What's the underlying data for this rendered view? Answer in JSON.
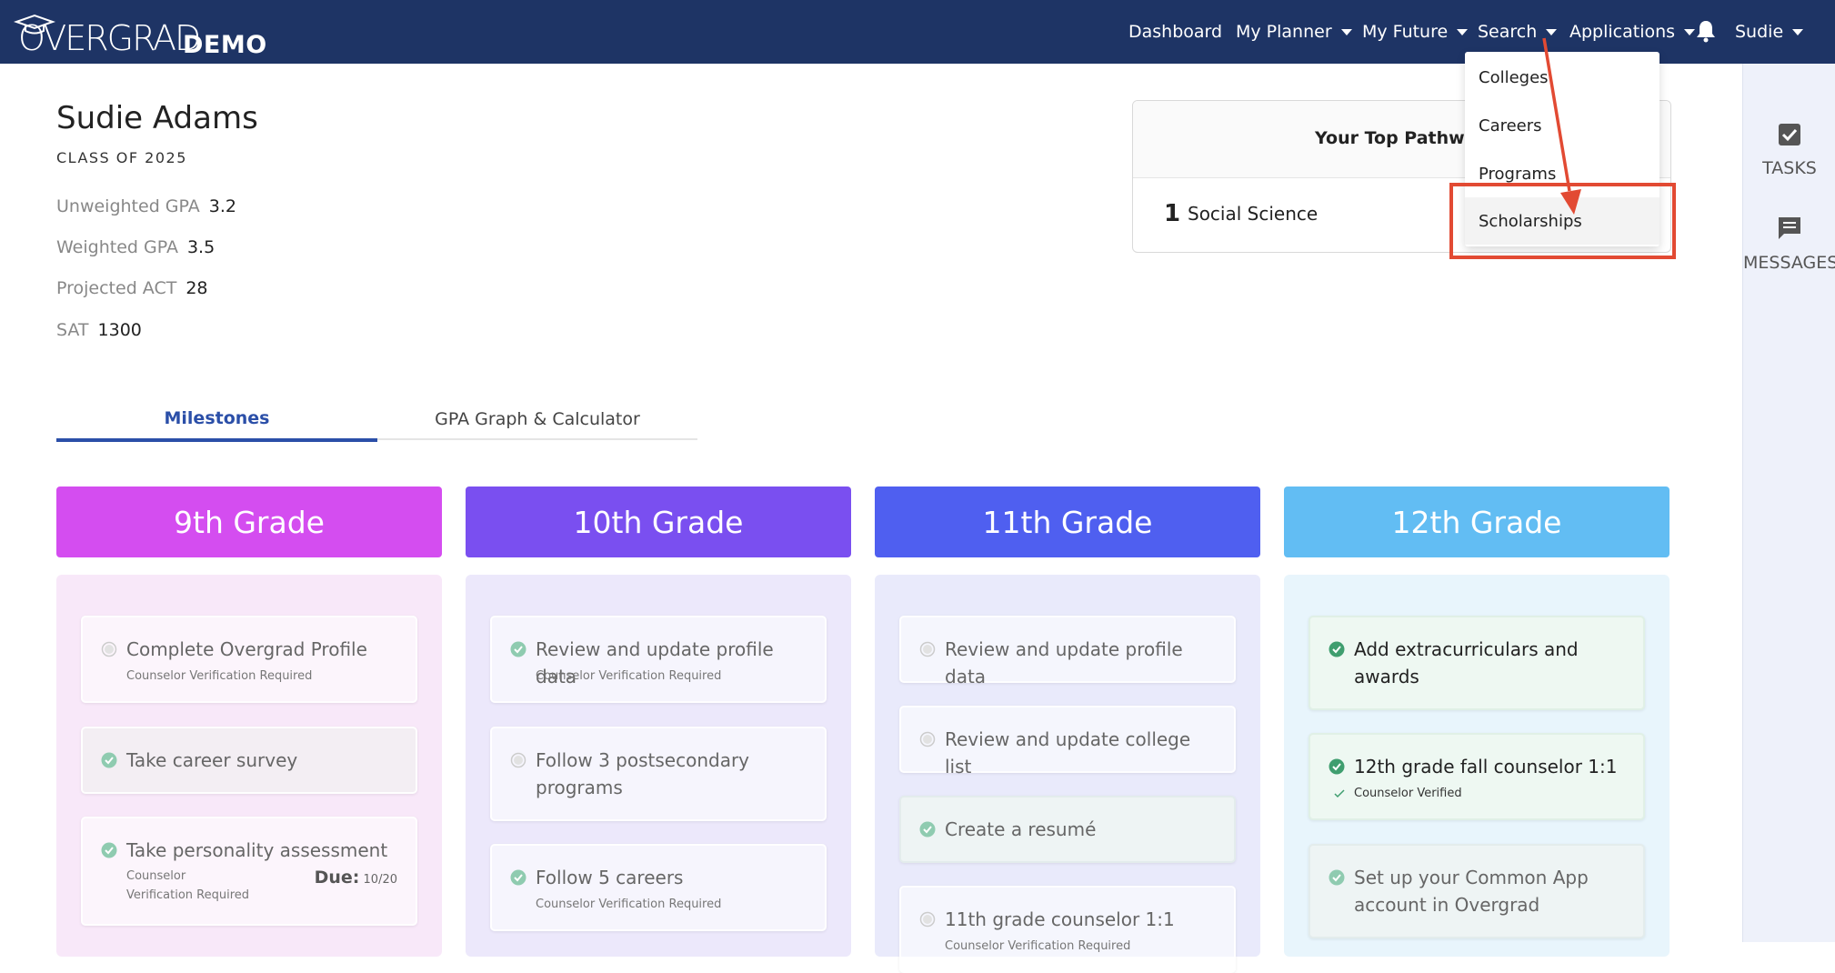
{
  "logo": {
    "wordmark": "OVERGRAD",
    "badge": "DEMO"
  },
  "nav": {
    "dashboard": "Dashboard",
    "my_planner": "My Planner",
    "my_future": "My Future",
    "search": "Search",
    "applications": "Applications",
    "user": "Sudie"
  },
  "search_menu": {
    "items": [
      "Colleges",
      "Careers",
      "Programs",
      "Scholarships"
    ],
    "highlighted": "Scholarships"
  },
  "annotation_color": "#e24a33",
  "rail": {
    "tasks": "TASKS",
    "messages": "MESSAGES"
  },
  "profile": {
    "name": "Sudie Adams",
    "class_of": "CLASS OF 2025",
    "stats": [
      {
        "label": "Unweighted GPA",
        "value": "3.2"
      },
      {
        "label": "Weighted GPA",
        "value": "3.5"
      },
      {
        "label": "Projected ACT",
        "value": "28"
      },
      {
        "label": "SAT",
        "value": "1300"
      }
    ]
  },
  "pathways": {
    "title": "Your Top Pathways",
    "rank": "1",
    "name": "Social Science"
  },
  "tabs": {
    "milestones": "Milestones",
    "gpa": "GPA Graph & Calculator"
  },
  "grades": [
    {
      "title": "9th Grade",
      "color": "#d44df0",
      "bg": "#f8e8f9",
      "tasks": [
        {
          "title": "Complete Overgrad Profile",
          "sub": "Counselor Verification Required",
          "status": "pending"
        },
        {
          "title": "Take career survey",
          "sub": "",
          "status": "complete"
        },
        {
          "title": "Take personality assessment",
          "sub": "Counselor Verification Required",
          "due_label": "Due:",
          "due_date": "10/20",
          "status": "complete"
        }
      ]
    },
    {
      "title": "10th Grade",
      "color": "#7a4ff0",
      "bg": "#ece8fb",
      "tasks": [
        {
          "title": "Review and update profile data",
          "sub": "Counselor Verification Required",
          "status": "complete"
        },
        {
          "title": "Follow 3 postsecondary programs",
          "sub": "",
          "status": "pending"
        },
        {
          "title": "Follow 5 careers",
          "sub": "Counselor Verification Required",
          "status": "complete"
        }
      ]
    },
    {
      "title": "11th Grade",
      "color": "#4f5ff0",
      "bg": "#e9eafb",
      "tasks": [
        {
          "title": "Review and update profile data",
          "sub": "",
          "status": "pending"
        },
        {
          "title": "Review and update college list",
          "sub": "",
          "status": "pending"
        },
        {
          "title": "Create a resumé",
          "sub": "",
          "status": "complete"
        },
        {
          "title": "11th grade counselor 1:1",
          "sub": "Counselor Verification Required",
          "status": "pending"
        }
      ]
    },
    {
      "title": "12th Grade",
      "color": "#62bdf3",
      "bg": "#e8f5fc",
      "tasks": [
        {
          "title": "Add extracurriculars and awards",
          "sub": "",
          "status": "done"
        },
        {
          "title": "12th grade fall counselor 1:1",
          "sub": "Counselor Verified",
          "status": "done"
        },
        {
          "title": "Set up your Common App account in Overgrad",
          "sub": "",
          "status": "complete"
        }
      ]
    }
  ]
}
